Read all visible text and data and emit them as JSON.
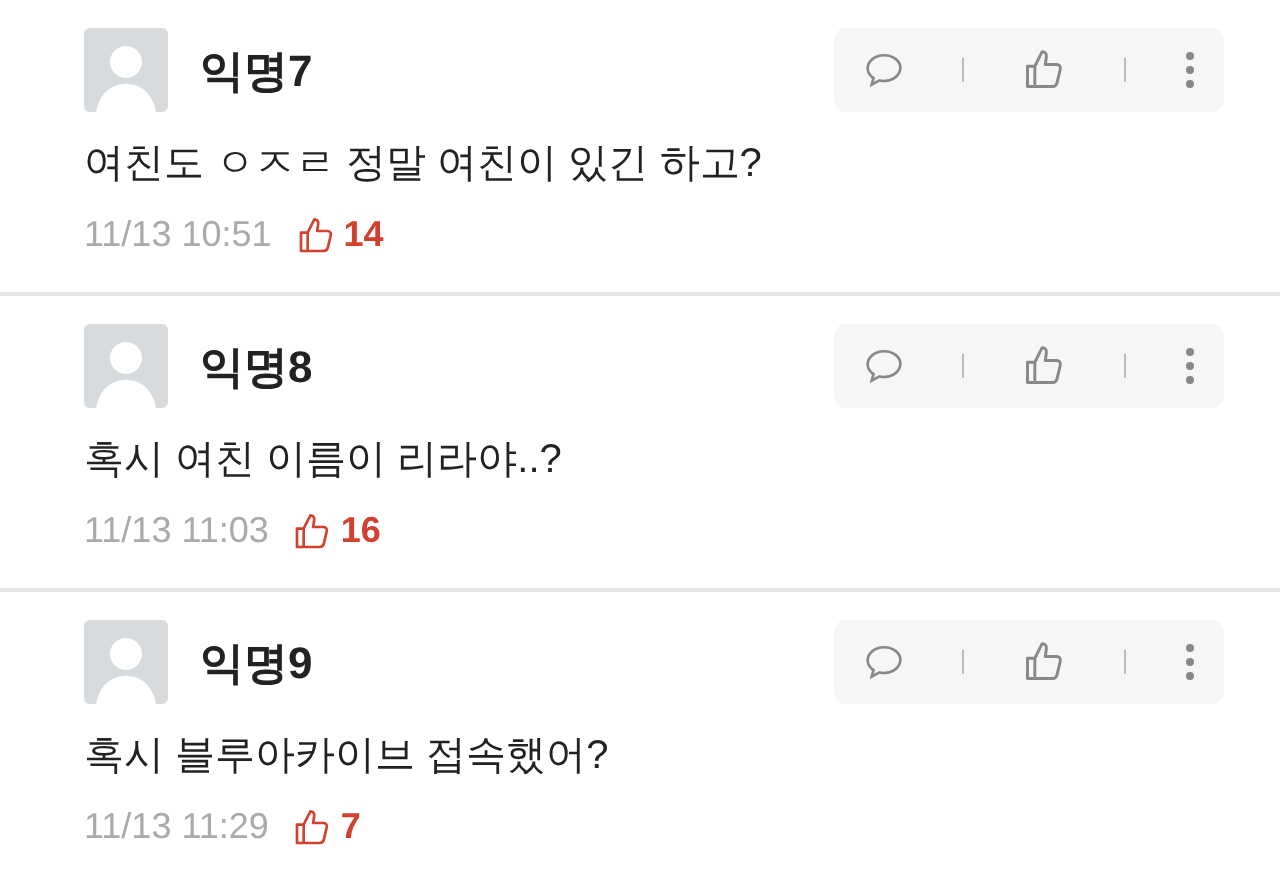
{
  "comments": [
    {
      "author": "익명7",
      "text": "여친도 ㅇㅈㄹ 정말 여친이 있긴 하고?",
      "time": "11/13 10:51",
      "likes": "14"
    },
    {
      "author": "익명8",
      "text": "혹시 여친 이름이 리라야..?",
      "time": "11/13 11:03",
      "likes": "16"
    },
    {
      "author": "익명9",
      "text": "혹시 블루아카이브 접속했어?",
      "time": "11/13 11:29",
      "likes": "7"
    }
  ]
}
